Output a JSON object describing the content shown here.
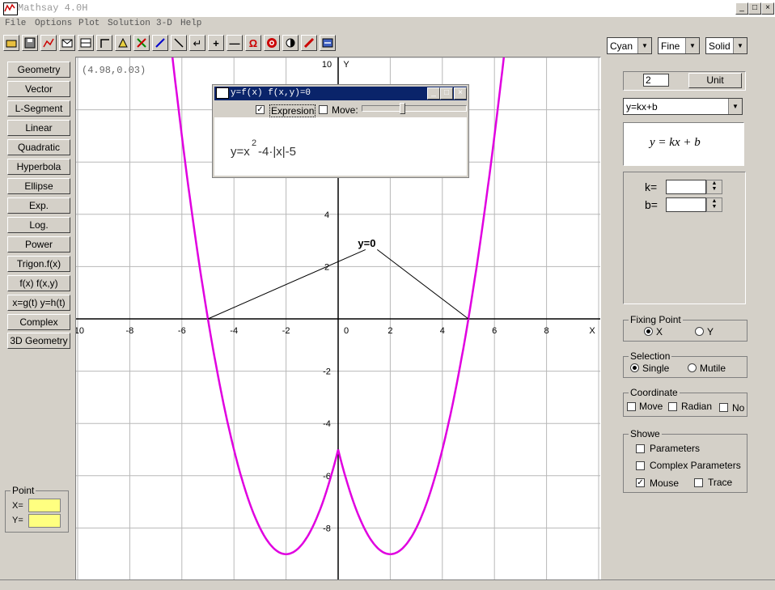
{
  "window": {
    "title": "Mathsay 4.0H",
    "minimize": "_",
    "maximize": "□",
    "close": "×"
  },
  "menu": [
    "File",
    "Options",
    "Plot",
    "Solution",
    "3-D",
    "Help"
  ],
  "toolbar": {
    "icons": [
      "open-icon",
      "save-icon",
      "chart-icon",
      "envelope-icon",
      "grid-icon",
      "axes-icon",
      "triangle-icon",
      "cross-icon",
      "pen-icon",
      "line-icon",
      "arrow-icon",
      "plus-icon",
      "minus-icon",
      "magnet-icon",
      "target-icon",
      "half-icon",
      "pencil-icon",
      "export-icon"
    ]
  },
  "style_selects": {
    "color": "Cyan",
    "quality": "Fine",
    "line": "Solid"
  },
  "left_buttons": [
    "Geometry",
    "Vector",
    "L-Segment",
    "Linear",
    "Quadratic",
    "Hyperbola",
    "Ellipse",
    "Exp.",
    "Log.",
    "Power",
    "Trigon.f(x)",
    "f(x)  f(x,y)",
    "x=g(t) y=h(t)",
    "Complex",
    "3D Geometry"
  ],
  "point_panel": {
    "title": "Point",
    "x_label": "X=",
    "y_label": "Y=",
    "x_value": "",
    "y_value": ""
  },
  "plot": {
    "coord_readout": "(4.98,0.03)",
    "x_axis_label": "X",
    "y_axis_label": "Y",
    "x_ticks": [
      "-10",
      "-8",
      "-6",
      "-4",
      "-2",
      "0",
      "2",
      "4",
      "6",
      "8"
    ],
    "y_ticks": [
      "10",
      "4",
      "2",
      "-2",
      "-4",
      "-6",
      "-8"
    ],
    "root_label": "y=0",
    "curve_color": "#e000e0"
  },
  "chart_data": {
    "type": "line",
    "function": "y=x^2-4|x|-5",
    "xlim": [
      -10,
      10
    ],
    "ylim": [
      -10,
      10
    ],
    "roots": [
      -5,
      5
    ],
    "vertex_points": [
      [
        -2,
        -9
      ],
      [
        0,
        -5
      ],
      [
        2,
        -9
      ]
    ],
    "grid": true
  },
  "dialog": {
    "title": "y=f(x)  f(x,y)=0",
    "expression_check_label": "Expresion",
    "expression_checked": true,
    "move_check_label": "Move:",
    "move_checked": false,
    "slider_fraction": 0.38,
    "formula_text": {
      "lhs": "y=x",
      "exp": "2",
      "rest": "-4·|x|-5"
    }
  },
  "right_panel": {
    "unit_value": "2",
    "unit_button": "Unit",
    "function_select": "y=kx+b",
    "formula": "y = kx + b",
    "params": {
      "k_label": "k=",
      "b_label": "b=",
      "k_value": "",
      "b_value": ""
    },
    "fixing_point": {
      "title": "Fixing Point",
      "options": [
        "X",
        "Y"
      ],
      "selected": "X"
    },
    "selection": {
      "title": "Selection",
      "options": [
        "Single",
        "Mutile"
      ],
      "selected": "Single"
    },
    "coordinate": {
      "title": "Coordinate",
      "options": [
        "Move",
        "Radian",
        "No"
      ]
    },
    "showe": {
      "title": "Showe",
      "parameters": "Parameters",
      "complex_parameters": "Complex Parameters",
      "mouse": "Mouse",
      "mouse_checked": true,
      "trace": "Trace"
    }
  }
}
